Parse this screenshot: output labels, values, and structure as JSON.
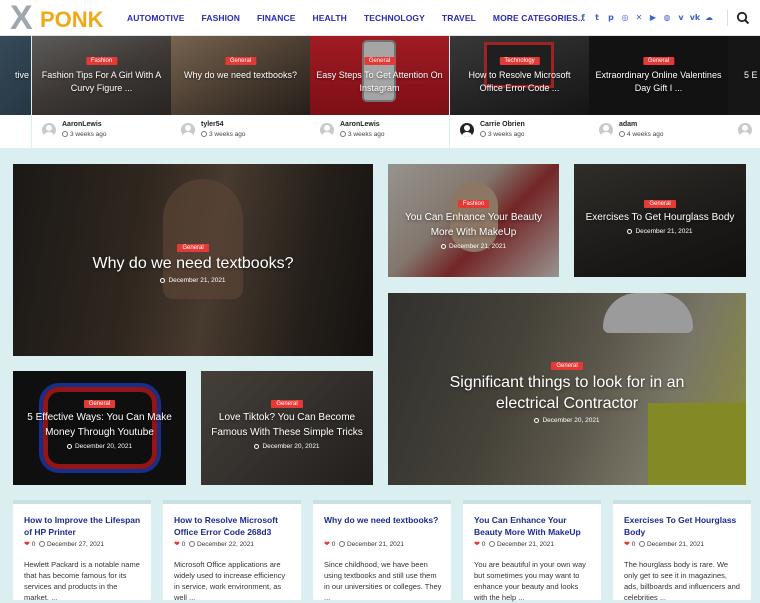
{
  "brand": {
    "logo_x": "X",
    "logo_text": "PONK"
  },
  "nav": {
    "items": [
      "AUTOMOTIVE",
      "FASHION",
      "FINANCE",
      "HEALTH",
      "TECHNOLOGY",
      "TRAVEL",
      "MORE CATEGORIES..."
    ],
    "socials": [
      "facebook-icon",
      "twitter-icon",
      "pinterest-icon",
      "instagram-icon",
      "xing-icon",
      "youtube-icon",
      "dribbble-icon",
      "vimeo-icon",
      "vk-icon",
      "soundcloud-icon"
    ]
  },
  "strip": [
    {
      "badge": "",
      "title": "tive",
      "author": "",
      "time": ""
    },
    {
      "badge": "Fashion",
      "title": "Fashion Tips For A Girl With A Curvy Figure ...",
      "author": "AaronLewis",
      "time": "3 weeks ago"
    },
    {
      "badge": "General",
      "title": "Why do we need textbooks?",
      "author": "tyler54",
      "time": "3 weeks ago"
    },
    {
      "badge": "General",
      "title": "Easy Steps To Get Attention On Instagram",
      "author": "AaronLewis",
      "time": "3 weeks ago"
    },
    {
      "badge": "Technology",
      "title": "How to Resolve Microsoft Office Error Code ...",
      "author": "Carrie Obrien",
      "time": "3 weeks ago"
    },
    {
      "badge": "General",
      "title": "Extraordinary Online Valentines Day Gift I ...",
      "author": "adam",
      "time": "4 weeks ago"
    },
    {
      "badge": "",
      "title": "5 E",
      "author": "",
      "time": ""
    }
  ],
  "featured": [
    {
      "badge": "General",
      "title": "Why do we need textbooks?",
      "date": "December 21, 2021"
    },
    {
      "badge": "Fashion",
      "title": "You Can Enhance Your Beauty More With MakeUp",
      "date": "December 21, 2021"
    },
    {
      "badge": "General",
      "title": "Exercises To Get Hourglass Body",
      "date": "December 21, 2021"
    },
    {
      "badge": "General",
      "title": "Significant things to look for in an electrical Contractor",
      "date": "December 20, 2021"
    },
    {
      "badge": "General",
      "title": "5 Effective Ways: You Can Make Money Through Youtube",
      "date": "December 20, 2021"
    },
    {
      "badge": "General",
      "title": "Love Tiktok? You Can Become Famous With These Simple Tricks",
      "date": "December 20, 2021"
    }
  ],
  "posts": [
    {
      "title": "How to Improve the Lifespan of HP Printer",
      "likes": "0",
      "date": "December 27, 2021",
      "excerpt": "Hewlett Packard is a notable name that has become famous for its services and products in the market. ..."
    },
    {
      "title": "How to Resolve Microsoft Office Error Code 268d3",
      "likes": "0",
      "date": "December 22, 2021",
      "excerpt": "Microsoft Office applications are widely used to increase efficiency in service, work environment, as well ..."
    },
    {
      "title": "Why do we need textbooks?",
      "likes": "0",
      "date": "December 21, 2021",
      "excerpt": "Since childhood, we have been using textbooks and still use them in our universities or colleges. They ..."
    },
    {
      "title": "You Can Enhance Your Beauty More With MakeUp",
      "likes": "0",
      "date": "December 21, 2021",
      "excerpt": "You are beautiful in your own way but sometimes you may want to enhance your beauty and looks with the help ..."
    },
    {
      "title": "Exercises To Get Hourglass Body",
      "likes": "0",
      "date": "December 21, 2021",
      "excerpt": "The hourglass body is rare. We only get to see it in magazines, ads, billboards and influencers and celebrities ..."
    }
  ],
  "colors": {
    "accent": "#e53935",
    "nav_link": "#2a2ab8",
    "post_title": "#1c2b8f",
    "logo_orange": "#f0a81a",
    "background": "#dceff0"
  }
}
